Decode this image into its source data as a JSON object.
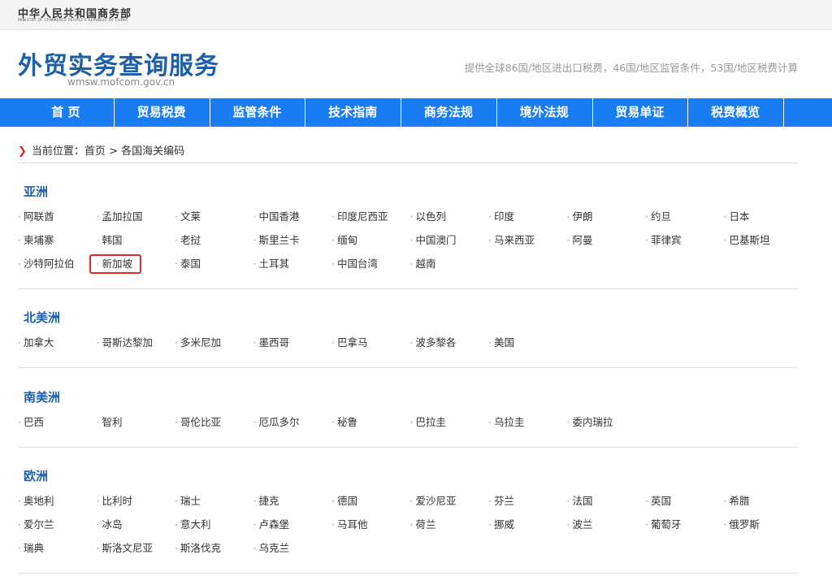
{
  "ministry": {
    "cn": "中华人民共和国商务部",
    "en": "MINISTRY OF COMMERCE PEOPLE'S REPUBLIC OF CHINA"
  },
  "site": {
    "title": "外贸实务查询服务",
    "url": "wmsw.mofcom.gov.cn",
    "desc": "提供全球86国/地区进出口税费，46国/地区监管条件，53国/地区税费计算"
  },
  "nav": [
    "首 页",
    "贸易税费",
    "监管条件",
    "技术指南",
    "商务法规",
    "境外法规",
    "贸易单证",
    "税费概览"
  ],
  "breadcrumb": {
    "label": "当前位置：",
    "home": "首页",
    "sep": ">",
    "current": "各国海关编码"
  },
  "regions": [
    {
      "name": "亚洲",
      "rows": [
        [
          "阿联酋",
          "孟加拉国",
          "文莱",
          "中国香港",
          "印度尼西亚",
          "以色列",
          "印度",
          "伊朗",
          "约旦",
          "日本"
        ],
        [
          "柬埔寨",
          "韩国",
          "老挝",
          "斯里兰卡",
          "缅甸",
          "中国澳门",
          "马来西亚",
          "阿曼",
          "菲律宾",
          "巴基斯坦"
        ],
        [
          "沙特阿拉伯",
          "新加坡",
          "泰国",
          "土耳其",
          "中国台湾",
          "越南"
        ]
      ]
    },
    {
      "name": "北美洲",
      "rows": [
        [
          "加拿大",
          "哥斯达黎加",
          "多米尼加",
          "墨西哥",
          "巴拿马",
          "波多黎各",
          "美国"
        ]
      ]
    },
    {
      "name": "南美洲",
      "rows": [
        [
          "巴西",
          "智利",
          "哥伦比亚",
          "厄瓜多尔",
          "秘鲁",
          "巴拉圭",
          "乌拉圭",
          "委内瑞拉"
        ]
      ]
    },
    {
      "name": "欧洲",
      "rows": [
        [
          "奥地利",
          "比利时",
          "瑞士",
          "捷克",
          "德国",
          "爱沙尼亚",
          "芬兰",
          "法国",
          "英国",
          "希腊"
        ],
        [
          "爱尔兰",
          "冰岛",
          "意大利",
          "卢森堡",
          "马耳他",
          "荷兰",
          "挪威",
          "波兰",
          "葡萄牙",
          "俄罗斯"
        ],
        [
          "瑞典",
          "斯洛文尼亚",
          "斯洛伐克",
          "乌克兰"
        ]
      ]
    }
  ]
}
